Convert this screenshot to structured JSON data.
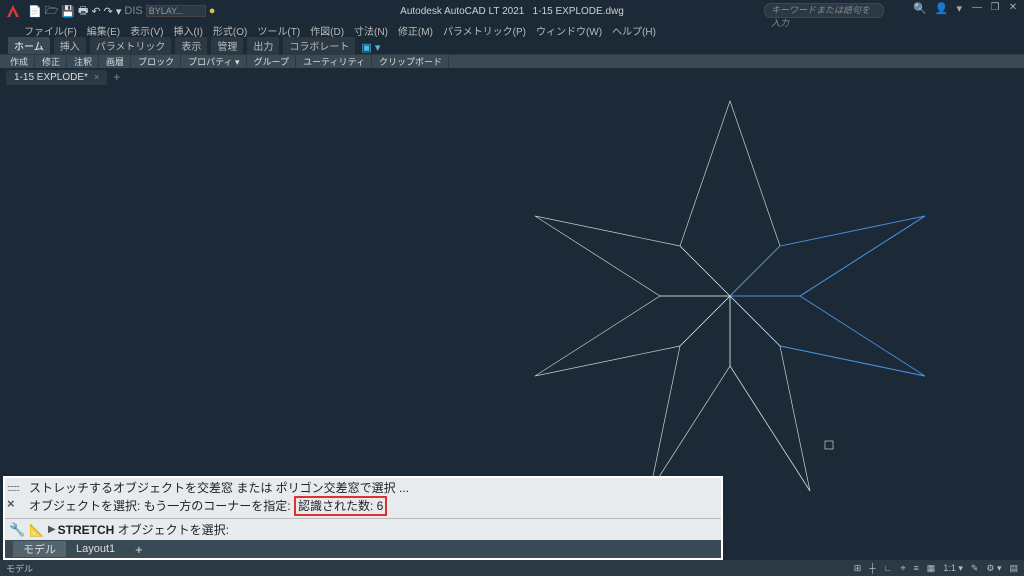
{
  "app": {
    "title": "Autodesk AutoCAD LT 2021",
    "doc": "1-15 EXPLODE.dwg"
  },
  "search": {
    "placeholder": "キーワードまたは語句を入力",
    "glyph": "🔍"
  },
  "wincontrols": {
    "min": "—",
    "max": "❐",
    "close": "✕"
  },
  "usericons": {
    "user": "👤",
    "help": "▾"
  },
  "menus": [
    "ファイル(F)",
    "編集(E)",
    "表示(V)",
    "挿入(I)",
    "形式(O)",
    "ツール(T)",
    "作図(D)",
    "寸法(N)",
    "修正(M)",
    "パラメトリック(P)",
    "ウィンドウ(W)",
    "ヘルプ(H)"
  ],
  "ribbontabs": [
    "ホーム",
    "挿入",
    "パラメトリック",
    "表示",
    "管理",
    "出力",
    "コラボレート"
  ],
  "extra_glyph": "▣ ▾",
  "panels": [
    "作成",
    "修正",
    "注釈",
    "画層",
    "ブロック",
    "プロパティ ▾",
    "グループ",
    "ユーティリティ",
    "クリップボード"
  ],
  "doctab": {
    "name": "1-15 EXPLODE*",
    "close": "×",
    "plus": "+"
  },
  "qat": {
    "icons": [
      "📄",
      "🗁",
      "💾",
      "🖶",
      "↶",
      "↷",
      "▾"
    ],
    "layer_label": "BYLAY...",
    "color_swatch": "●",
    "dis_label": "DIS"
  },
  "cmd": {
    "line1": "ストレッチするオブジェクトを交差窓 または ポリゴン交差窓で選択 ...",
    "line2a": "オブジェクトを選択: もう一方のコーナーを指定: ",
    "line2b": "認識された数: 6",
    "prompt_cmd": "STRETCH",
    "prompt_rest": " オブジェクトを選択:",
    "grip": "::::::::",
    "x": "×",
    "wrench": "🔧",
    "chev": "▶"
  },
  "layout": {
    "model": "モデル",
    "layout1": "Layout1",
    "plus": "+"
  },
  "status": {
    "left": "モデル",
    "items": [
      "⊞",
      "┼",
      "∟",
      "⌖",
      "≡",
      "▦",
      "1:1 ▾",
      "✎",
      "⚙ ▾",
      "▤"
    ]
  }
}
